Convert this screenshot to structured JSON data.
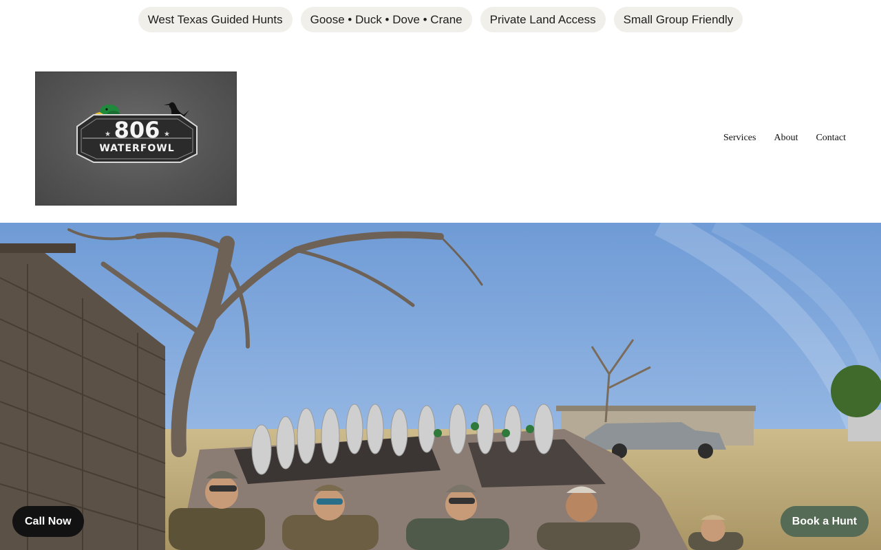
{
  "tags": [
    {
      "label": "West Texas Guided Hunts"
    },
    {
      "label": "Goose • Duck • Dove • Crane"
    },
    {
      "label": "Private Land Access"
    },
    {
      "label": "Small Group Friendly"
    }
  ],
  "logo": {
    "number": "806",
    "word": "WATERFOWL",
    "icons": [
      "mallard-head-icon",
      "crane-silhouette-icon"
    ]
  },
  "nav": {
    "items": [
      {
        "label": "Services"
      },
      {
        "label": "About"
      },
      {
        "label": "Contact"
      }
    ]
  },
  "hero": {
    "image": "hunters-with-harvested-birds-photo"
  },
  "cta": {
    "call_label": "Call Now",
    "book_label": "Book a Hunt"
  },
  "colors": {
    "pill_bg": "#f1efe9",
    "call_bg": "#121212",
    "book_bg": "#556b55",
    "sky": "#7fa6d9"
  }
}
